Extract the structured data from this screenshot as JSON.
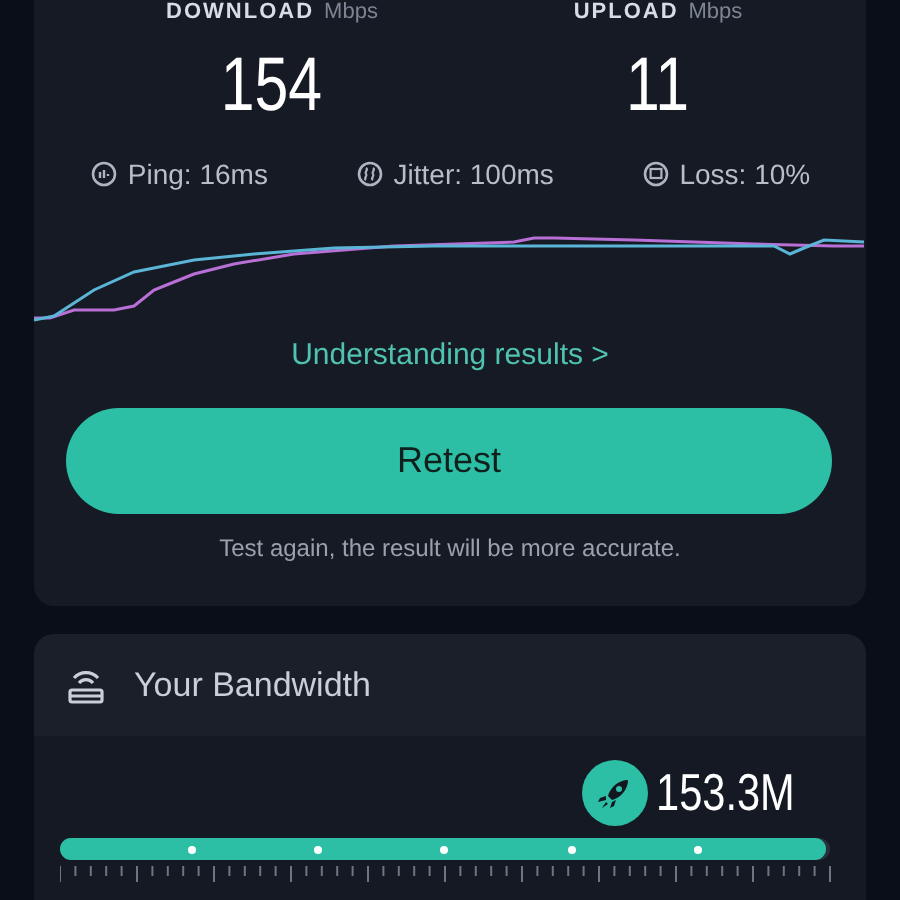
{
  "results": {
    "download": {
      "label": "DOWNLOAD",
      "unit": "Mbps",
      "value": "154"
    },
    "upload": {
      "label": "UPLOAD",
      "unit": "Mbps",
      "value": "11"
    },
    "metrics": [
      {
        "kind": "ping",
        "text": "Ping: 16ms"
      },
      {
        "kind": "jitter",
        "text": "Jitter: 100ms"
      },
      {
        "kind": "loss",
        "text": "Loss: 10%"
      }
    ],
    "link": "Understanding results >",
    "button": "Retest",
    "caption": "Test again, the result will be more accurate."
  },
  "bandwidth": {
    "title": "Your Bandwidth",
    "reading": "153.3M",
    "level": 0.995
  }
}
